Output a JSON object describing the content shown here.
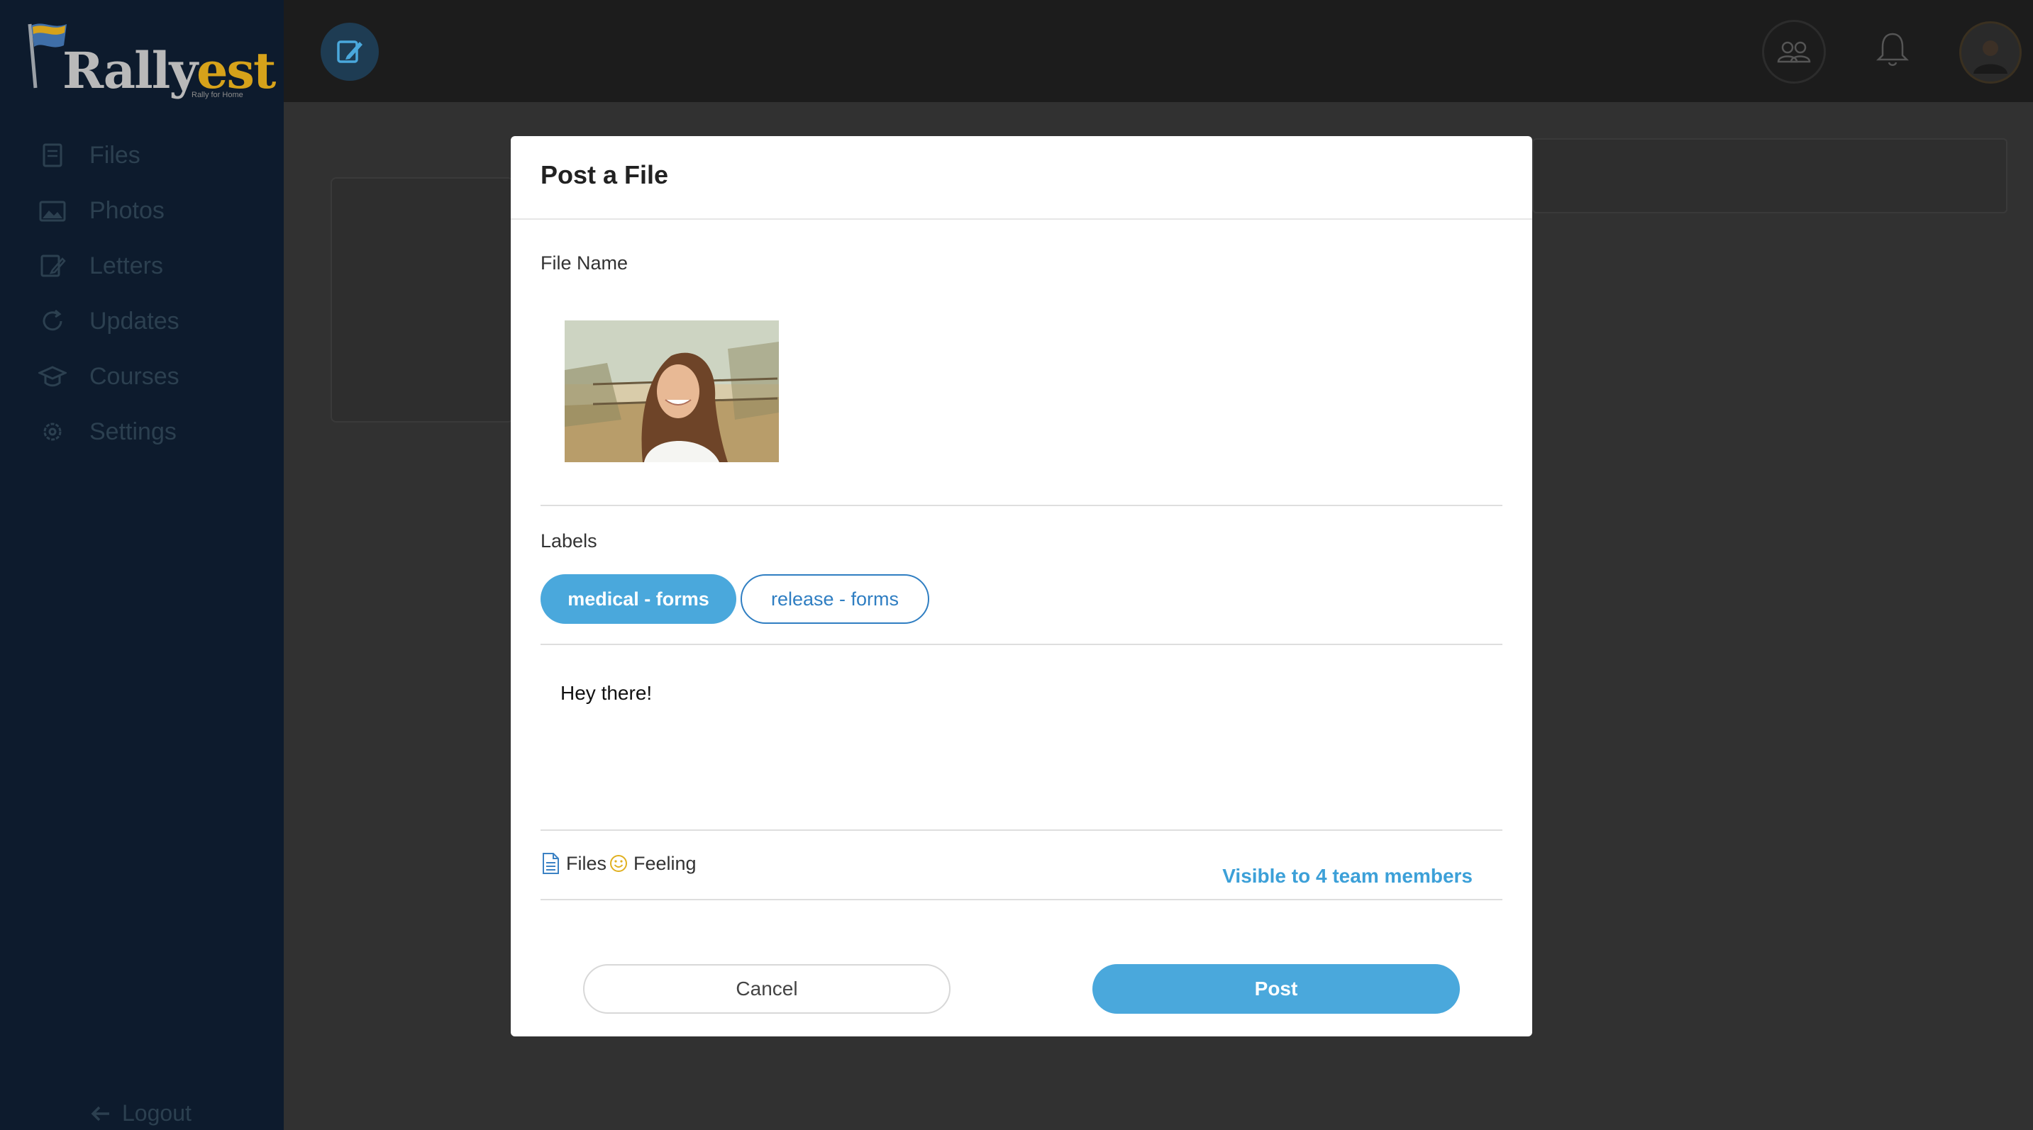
{
  "app": {
    "logo_text": "Rally",
    "logo_accent": "est",
    "tagline": "Rally for Home",
    "brand_color": "#d6a21a"
  },
  "sidebar": {
    "items": [
      {
        "label": "Files",
        "icon": "files-icon"
      },
      {
        "label": "Photos",
        "icon": "photos-icon"
      },
      {
        "label": "Letters",
        "icon": "letters-icon"
      },
      {
        "label": "Updates",
        "icon": "updates-icon"
      },
      {
        "label": "Courses",
        "icon": "courses-icon"
      },
      {
        "label": "Settings",
        "icon": "settings-icon"
      }
    ],
    "logout_label": "Logout"
  },
  "topbar": {
    "icons": [
      "compose-icon",
      "people-icon",
      "bell-icon",
      "avatar"
    ]
  },
  "modal": {
    "title": "Post a File",
    "file_name_label": "File Name",
    "labels_label": "Labels",
    "labels": [
      {
        "text": "medical - forms",
        "selected": true
      },
      {
        "text": "release - forms",
        "selected": false
      }
    ],
    "message": "Hey there!",
    "attach_files_label": "Files",
    "feeling_label": "Feeling",
    "visibility": "Visible to 4 team members",
    "cancel_label": "Cancel",
    "post_label": "Post",
    "accent_color": "#4aa8dc"
  }
}
